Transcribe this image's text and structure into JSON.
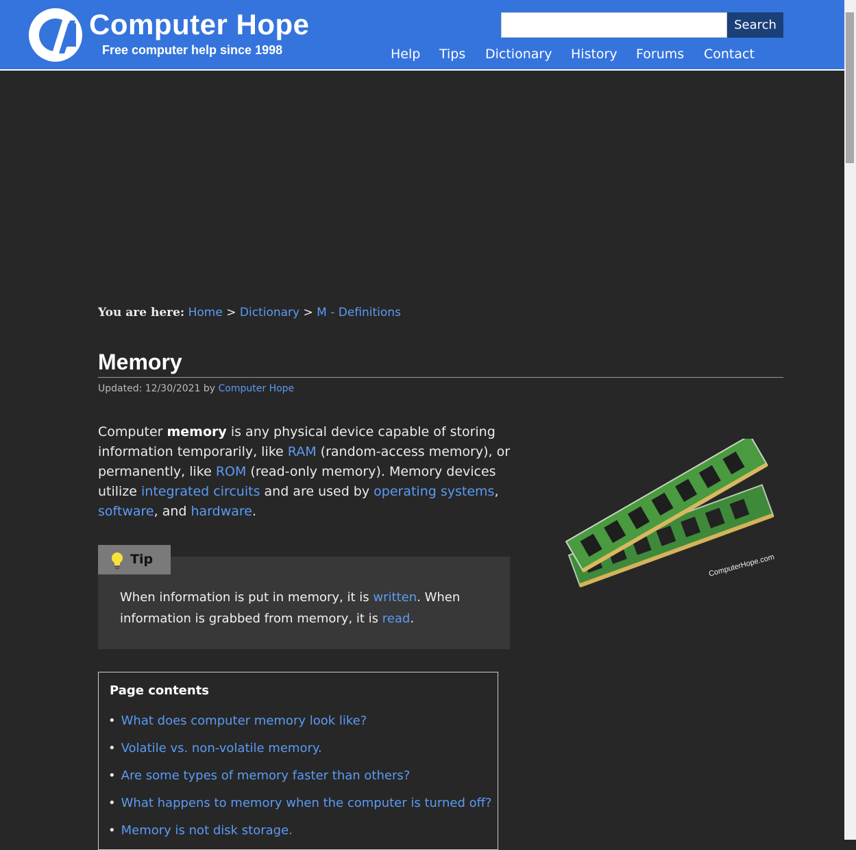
{
  "brand": {
    "title": "Computer Hope",
    "tagline": "Free computer help since 1998"
  },
  "search": {
    "placeholder": "",
    "button_label": "Search"
  },
  "nav": [
    "Help",
    "Tips",
    "Dictionary",
    "History",
    "Forums",
    "Contact"
  ],
  "breadcrumb": {
    "prefix": "You are here:",
    "items": [
      "Home",
      "Dictionary",
      "M - Definitions"
    ],
    "separator": ">"
  },
  "page": {
    "title": "Memory",
    "updated_label": "Updated: 12/30/2021 by",
    "author": "Computer Hope"
  },
  "intro": {
    "p1": "Computer ",
    "bold": "memory",
    "p2": " is any physical device capable of storing information temporarily, like ",
    "link_ram": "RAM",
    "p3": " (random-access memory), or permanently, like ",
    "link_rom": "ROM",
    "p4": " (read-only memory). Memory devices utilize ",
    "link_ic": "integrated circuits",
    "p5": " and are used by ",
    "link_os": "operating systems",
    "p6": ", ",
    "link_software": "software",
    "p7": ", and ",
    "link_hardware": "hardware",
    "p8": "."
  },
  "tip": {
    "label": "Tip",
    "t1": "When information is put in memory, it is ",
    "link_written": "written",
    "t2": ". When information is grabbed from memory, it is ",
    "link_read": "read",
    "t3": "."
  },
  "contents": {
    "title": "Page contents",
    "items": [
      "What does computer memory look like?",
      "Volatile vs. non-volatile memory.",
      "Are some types of memory faster than others?",
      "What happens to memory when the computer is turned off?",
      "Memory is not disk storage."
    ]
  },
  "image": {
    "watermark": "ComputerHope.com"
  },
  "colors": {
    "header_bg": "#3574dc",
    "page_bg": "#272727",
    "link": "#5b9bf5",
    "search_button": "#1b3f78"
  }
}
